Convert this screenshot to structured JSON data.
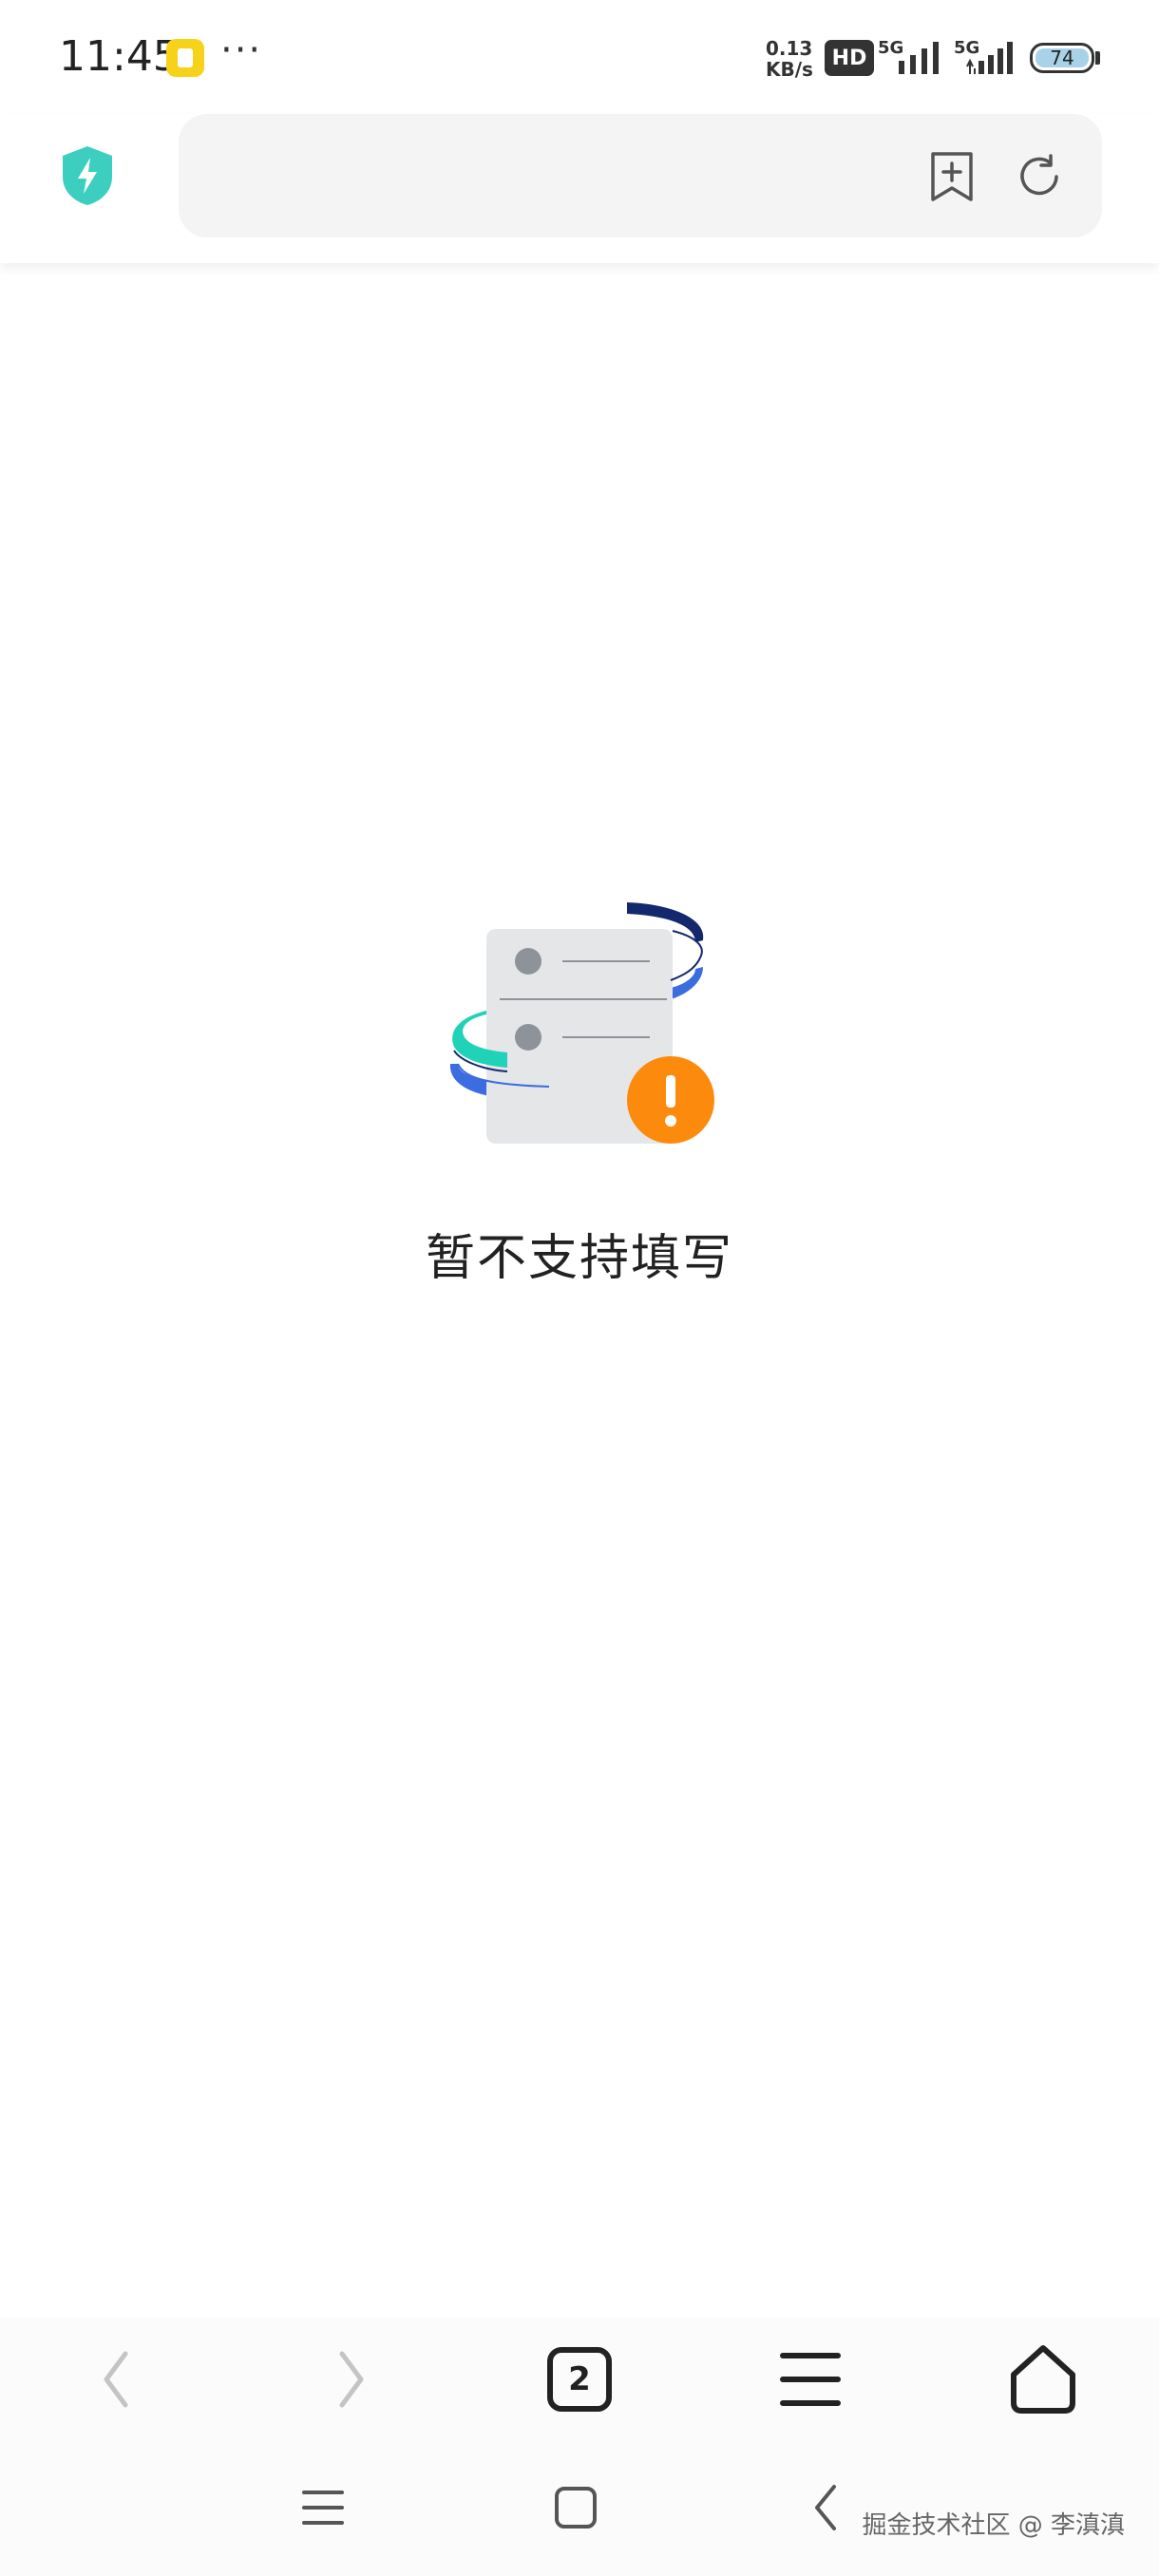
{
  "status_bar": {
    "time": "11:45",
    "more": "···",
    "net_speed_value": "0.13",
    "net_speed_unit": "KB/s",
    "hd_badge": "HD",
    "signal_1": "5G",
    "signal_2": "5G",
    "battery": "74"
  },
  "toolbar": {
    "shield_icon": "shield-lightning-icon",
    "url_value": "",
    "bookmark_icon": "bookmark-add-icon",
    "refresh_icon": "refresh-icon"
  },
  "empty_state": {
    "illustration": "document-error-illustration",
    "message": "暂不支持填写"
  },
  "bottom_nav": {
    "tab_count": "2"
  },
  "watermark": "掘金技术社区 @ 李滇滇",
  "colors": {
    "shield": "#3ccfbf",
    "accent_orange": "#fb8a0d",
    "stripe_blue": "#3b6ce0",
    "stripe_teal": "#1fd2b8",
    "stripe_navy": "#14286e"
  }
}
